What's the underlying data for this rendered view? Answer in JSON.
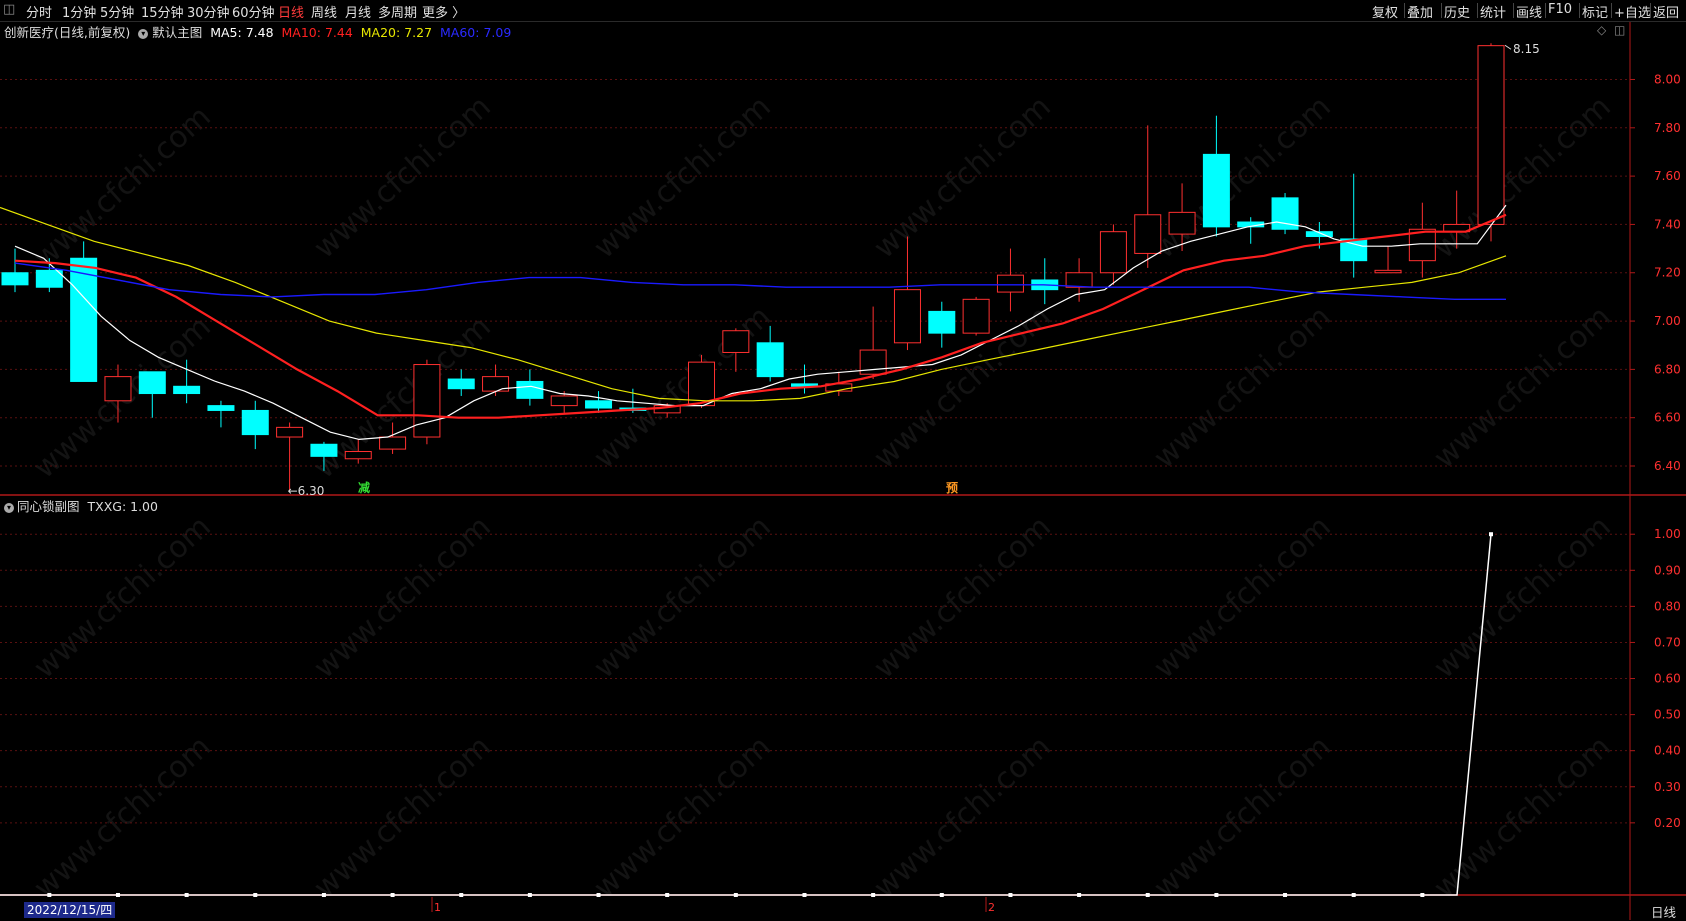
{
  "toolbar": {
    "left": [
      "分时",
      "1分钟",
      "5分钟",
      "15分钟",
      "30分钟",
      "60分钟",
      "日线",
      "周线",
      "月线",
      "多周期",
      "更多 〉"
    ],
    "active_index": 6,
    "right": [
      "复权",
      "叠加",
      "历史",
      "统计",
      "画线",
      "F10",
      "标记",
      "+自选",
      "返回"
    ]
  },
  "main_legend": {
    "name": "创新医疗(日线,前复权)",
    "template": "默认主图",
    "ma5": "MA5: 7.48",
    "ma10": "MA10: 7.44",
    "ma20": "MA20: 7.27",
    "ma60": "MA60: 7.09",
    "colors": {
      "ma5": "#ffffff",
      "ma10": "#ff2020",
      "ma20": "#e6e600",
      "ma60": "#1a1aff"
    }
  },
  "sub_legend": {
    "name": "同心锁副图",
    "value": "TXXG: 1.00"
  },
  "markers": {
    "high_label": "8.15",
    "low_label": "←6.30",
    "mark_a": "减",
    "mark_b": "预"
  },
  "watermark": "www.cfchi.com",
  "date_label": "2022/12/15/四",
  "period_label": "日线",
  "month_labels": [
    "1",
    "2"
  ],
  "chart_data": [
    {
      "type": "candlestick",
      "title": "",
      "y_ticks": [
        6.4,
        6.6,
        6.8,
        7.0,
        7.2,
        7.4,
        7.6,
        7.8,
        8.0
      ],
      "ylim": [
        6.28,
        8.18
      ],
      "candles": [
        {
          "o": 7.2,
          "h": 7.3,
          "l": 7.12,
          "c": 7.15
        },
        {
          "o": 7.21,
          "h": 7.26,
          "l": 7.12,
          "c": 7.14
        },
        {
          "o": 7.26,
          "h": 7.33,
          "l": 6.75,
          "c": 6.75
        },
        {
          "o": 6.67,
          "h": 6.82,
          "l": 6.58,
          "c": 6.77
        },
        {
          "o": 6.79,
          "h": 6.79,
          "l": 6.6,
          "c": 6.7
        },
        {
          "o": 6.73,
          "h": 6.84,
          "l": 6.66,
          "c": 6.7
        },
        {
          "o": 6.65,
          "h": 6.67,
          "l": 6.56,
          "c": 6.63
        },
        {
          "o": 6.63,
          "h": 6.67,
          "l": 6.47,
          "c": 6.53
        },
        {
          "o": 6.52,
          "h": 6.58,
          "l": 6.3,
          "c": 6.56
        },
        {
          "o": 6.49,
          "h": 6.5,
          "l": 6.38,
          "c": 6.44
        },
        {
          "o": 6.43,
          "h": 6.51,
          "l": 6.41,
          "c": 6.46
        },
        {
          "o": 6.47,
          "h": 6.58,
          "l": 6.45,
          "c": 6.52
        },
        {
          "o": 6.52,
          "h": 6.84,
          "l": 6.49,
          "c": 6.82
        },
        {
          "o": 6.76,
          "h": 6.8,
          "l": 6.69,
          "c": 6.72
        },
        {
          "o": 6.71,
          "h": 6.82,
          "l": 6.69,
          "c": 6.77
        },
        {
          "o": 6.75,
          "h": 6.8,
          "l": 6.65,
          "c": 6.68
        },
        {
          "o": 6.65,
          "h": 6.71,
          "l": 6.62,
          "c": 6.69
        },
        {
          "o": 6.67,
          "h": 6.71,
          "l": 6.62,
          "c": 6.64
        },
        {
          "o": 6.64,
          "h": 6.72,
          "l": 6.62,
          "c": 6.63
        },
        {
          "o": 6.62,
          "h": 6.66,
          "l": 6.6,
          "c": 6.65
        },
        {
          "o": 6.65,
          "h": 6.86,
          "l": 6.64,
          "c": 6.83
        },
        {
          "o": 6.87,
          "h": 6.97,
          "l": 6.79,
          "c": 6.96
        },
        {
          "o": 6.91,
          "h": 6.98,
          "l": 6.75,
          "c": 6.77
        },
        {
          "o": 6.74,
          "h": 6.82,
          "l": 6.7,
          "c": 6.73
        },
        {
          "o": 6.71,
          "h": 6.79,
          "l": 6.69,
          "c": 6.74
        },
        {
          "o": 6.78,
          "h": 7.06,
          "l": 6.76,
          "c": 6.88
        },
        {
          "o": 6.91,
          "h": 7.35,
          "l": 6.88,
          "c": 7.13
        },
        {
          "o": 7.04,
          "h": 7.08,
          "l": 6.89,
          "c": 6.95
        },
        {
          "o": 6.95,
          "h": 7.1,
          "l": 6.94,
          "c": 7.09
        },
        {
          "o": 7.12,
          "h": 7.3,
          "l": 7.04,
          "c": 7.19
        },
        {
          "o": 7.17,
          "h": 7.26,
          "l": 7.07,
          "c": 7.13
        },
        {
          "o": 7.14,
          "h": 7.26,
          "l": 7.08,
          "c": 7.2
        },
        {
          "o": 7.2,
          "h": 7.4,
          "l": 7.15,
          "c": 7.37
        },
        {
          "o": 7.28,
          "h": 7.81,
          "l": 7.22,
          "c": 7.44
        },
        {
          "o": 7.36,
          "h": 7.57,
          "l": 7.29,
          "c": 7.45
        },
        {
          "o": 7.69,
          "h": 7.85,
          "l": 7.35,
          "c": 7.39
        },
        {
          "o": 7.41,
          "h": 7.43,
          "l": 7.32,
          "c": 7.39
        },
        {
          "o": 7.51,
          "h": 7.53,
          "l": 7.36,
          "c": 7.38
        },
        {
          "o": 7.37,
          "h": 7.41,
          "l": 7.3,
          "c": 7.35
        },
        {
          "o": 7.34,
          "h": 7.61,
          "l": 7.18,
          "c": 7.25
        },
        {
          "o": 7.2,
          "h": 7.31,
          "l": 7.2,
          "c": 7.21
        },
        {
          "o": 7.25,
          "h": 7.49,
          "l": 7.18,
          "c": 7.38
        },
        {
          "o": 7.37,
          "h": 7.54,
          "l": 7.3,
          "c": 7.4
        },
        {
          "o": 7.4,
          "h": 8.15,
          "l": 7.33,
          "c": 8.14
        }
      ],
      "series": [
        {
          "name": "MA5",
          "values": [
            7.31,
            7.26,
            7.15,
            7.02,
            6.92,
            6.85,
            6.8,
            6.75,
            6.71,
            6.66,
            6.6,
            6.54,
            6.51,
            6.52,
            6.57,
            6.6,
            6.67,
            6.72,
            6.73,
            6.7,
            6.69,
            6.67,
            6.66,
            6.65,
            6.65,
            6.7,
            6.72,
            6.76,
            6.78,
            6.79,
            6.8,
            6.81,
            6.82,
            6.86,
            6.92,
            6.98,
            7.05,
            7.11,
            7.13,
            7.22,
            7.29,
            7.33,
            7.36,
            7.39,
            7.41,
            7.39,
            7.34,
            7.31,
            7.31,
            7.32,
            7.32,
            7.32,
            7.48
          ]
        },
        {
          "name": "MA10",
          "values": [
            7.25,
            7.24,
            7.22,
            7.18,
            7.1,
            7.0,
            6.9,
            6.8,
            6.71,
            6.61,
            6.61,
            6.6,
            6.6,
            6.61,
            6.62,
            6.63,
            6.64,
            6.66,
            6.7,
            6.72,
            6.73,
            6.76,
            6.8,
            6.85,
            6.91,
            6.95,
            6.99,
            7.05,
            7.13,
            7.21,
            7.25,
            7.27,
            7.31,
            7.33,
            7.35,
            7.37,
            7.37,
            7.44
          ]
        },
        {
          "name": "MA20",
          "values": [
            7.47,
            7.4,
            7.33,
            7.28,
            7.23,
            7.16,
            7.08,
            7.0,
            6.95,
            6.92,
            6.89,
            6.84,
            6.78,
            6.72,
            6.68,
            6.67,
            6.67,
            6.68,
            6.72,
            6.75,
            6.8,
            6.84,
            6.88,
            6.92,
            6.96,
            7.0,
            7.04,
            7.08,
            7.12,
            7.14,
            7.16,
            7.2,
            7.27
          ]
        },
        {
          "name": "MA60",
          "values": [
            7.24,
            7.21,
            7.17,
            7.13,
            7.11,
            7.1,
            7.11,
            7.11,
            7.13,
            7.16,
            7.18,
            7.18,
            7.16,
            7.15,
            7.15,
            7.14,
            7.14,
            7.14,
            7.15,
            7.15,
            7.15,
            7.14,
            7.14,
            7.14,
            7.14,
            7.12,
            7.11,
            7.1,
            7.09,
            7.09
          ]
        }
      ]
    },
    {
      "type": "line",
      "title": "",
      "y_ticks": [
        0.2,
        0.3,
        0.4,
        0.5,
        0.6,
        0.7,
        0.8,
        0.9,
        1.0
      ],
      "ylim": [
        0.0,
        1.02
      ],
      "series": [
        {
          "name": "TXXG",
          "values": [
            0,
            0,
            0,
            0,
            0,
            0,
            0,
            0,
            0,
            0,
            0,
            0,
            0,
            0,
            0,
            0,
            0,
            0,
            0,
            0,
            0,
            0,
            0,
            0,
            0,
            0,
            0,
            0,
            0,
            0,
            0,
            0,
            0,
            0,
            0,
            0,
            0,
            0,
            0,
            0,
            0,
            0,
            0,
            1.0
          ]
        }
      ]
    }
  ]
}
